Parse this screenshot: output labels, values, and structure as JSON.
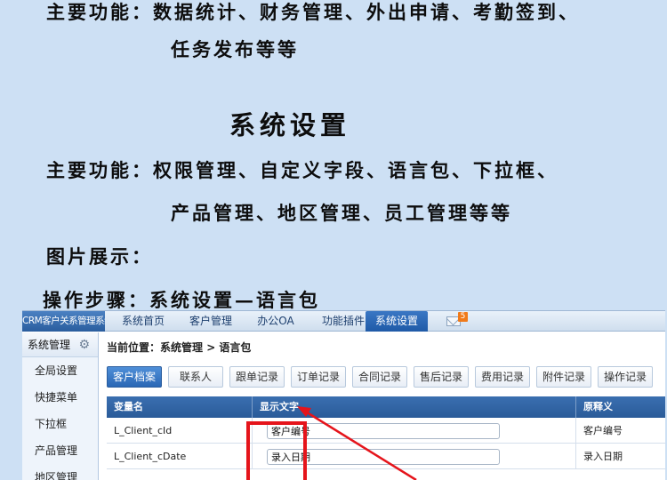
{
  "promo": {
    "line1": "主要功能：数据统计、财务管理、外出申请、考勤签到、",
    "line2": "任务发布等等",
    "section_title": "系统设置",
    "line3": "主要功能：权限管理、自定义字段、语言包、下拉框、",
    "line4": "产品管理、地区管理、员工管理等等",
    "line5": "图片展示：",
    "line6": "操作步骤：系统设置—语言包"
  },
  "app": {
    "logo": "CRM客户关系管理系统",
    "nav": [
      {
        "label": "系统首页",
        "active": false
      },
      {
        "label": "客户管理",
        "active": false
      },
      {
        "label": "办公OA",
        "active": false
      },
      {
        "label": "功能插件",
        "active": false
      },
      {
        "label": "系统设置",
        "active": true
      }
    ],
    "mail_badge": "5",
    "sidebar": {
      "title": "系统管理",
      "items": [
        "全局设置",
        "快捷菜单",
        "下拉框",
        "产品管理",
        "地区管理"
      ]
    },
    "breadcrumb": {
      "prefix": "当前位置：",
      "path": "系统管理 > 语言包"
    },
    "tabs": [
      {
        "label": "客户档案",
        "active": true
      },
      {
        "label": "联系人",
        "active": false
      },
      {
        "label": "跟单记录",
        "active": false
      },
      {
        "label": "订单记录",
        "active": false
      },
      {
        "label": "合同记录",
        "active": false
      },
      {
        "label": "售后记录",
        "active": false
      },
      {
        "label": "费用记录",
        "active": false
      },
      {
        "label": "附件记录",
        "active": false
      },
      {
        "label": "操作记录",
        "active": false
      }
    ],
    "table": {
      "headers": [
        "变量名",
        "显示文字",
        "原释义"
      ],
      "rows": [
        {
          "var": "L_Client_cId",
          "display": "客户编号",
          "original": "客户编号"
        },
        {
          "var": "L_Client_cDate",
          "display": "录入日期",
          "original": "录入日期"
        }
      ]
    }
  },
  "colors": {
    "page_bg": "#cde0f4",
    "accent_blue": "#2a67b5",
    "highlight_red": "#e5141b"
  }
}
